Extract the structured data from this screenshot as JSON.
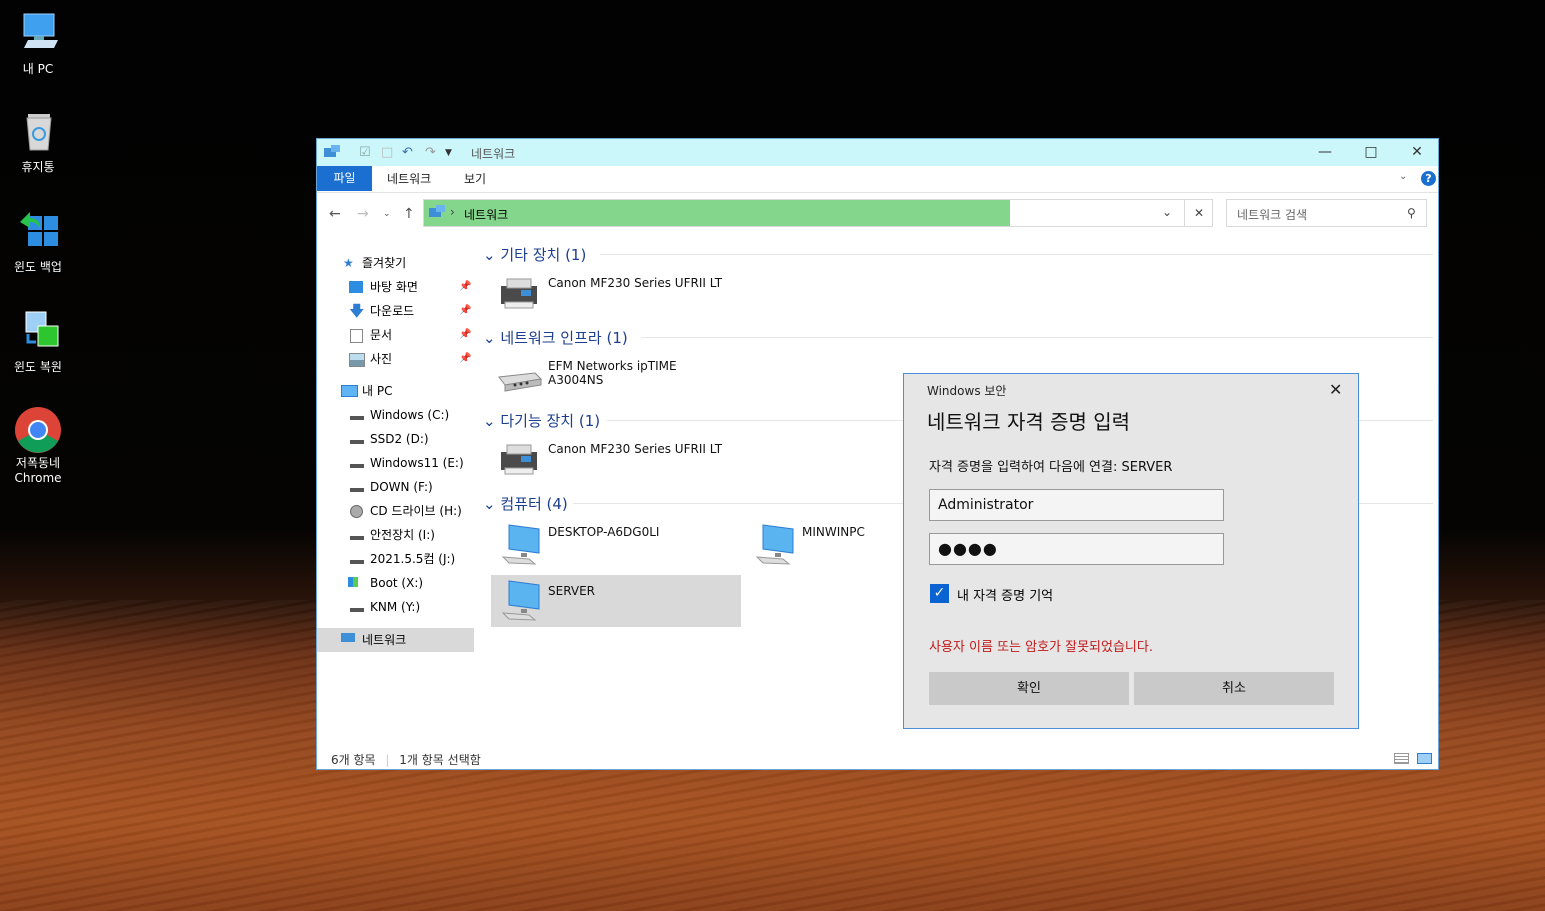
{
  "desktop": {
    "icons": [
      {
        "label": "내 PC"
      },
      {
        "label": "휴지통"
      },
      {
        "label": "윈도 백업"
      },
      {
        "label": "윈도 복원"
      },
      {
        "label": "저폭동네\nChrome"
      }
    ]
  },
  "explorer": {
    "title": "네트워크",
    "tabs": {
      "file": "파일",
      "network": "네트워크",
      "view": "보기"
    },
    "address": "네트워크",
    "search_placeholder": "네트워크 검색",
    "nav": [
      {
        "label": "즐겨찾기"
      },
      {
        "label": "바탕 화면"
      },
      {
        "label": "다운로드"
      },
      {
        "label": "문서"
      },
      {
        "label": "사진"
      },
      {
        "label": "내 PC"
      },
      {
        "label": "Windows (C:)"
      },
      {
        "label": "SSD2 (D:)"
      },
      {
        "label": "Windows11 (E:)"
      },
      {
        "label": "DOWN (F:)"
      },
      {
        "label": "CD 드라이브 (H:)"
      },
      {
        "label": "안전장치 (I:)"
      },
      {
        "label": "2021.5.5컴 (J:)"
      },
      {
        "label": "Boot (X:)"
      },
      {
        "label": "KNM (Y:)"
      },
      {
        "label": "네트워크"
      }
    ],
    "groups": [
      {
        "label": "기타 장치 (1)",
        "items": [
          "Canon MF230 Series UFRII LT"
        ]
      },
      {
        "label": "네트워크 인프라 (1)",
        "items": [
          "EFM Networks ipTIME A3004NS"
        ]
      },
      {
        "label": "다기능 장치 (1)",
        "items": [
          "Canon MF230 Series UFRII LT"
        ]
      },
      {
        "label": "컴퓨터 (4)",
        "items": [
          "DESKTOP-A6DG0LI",
          "MINWINPC",
          "SERVER"
        ]
      }
    ],
    "status": {
      "count": "6개 항목",
      "selected": "1개 항목 선택함"
    }
  },
  "dialog": {
    "caption": "Windows 보안",
    "heading": "네트워크 자격 증명 입력",
    "subtitle": "자격 증명을 입력하여 다음에 연결: SERVER",
    "username": "Administrator",
    "password_mask": "●●●●",
    "remember_label": "내 자격 증명 기억",
    "remember_checked": true,
    "error": "사용자 이름 또는 암호가 잘못되었습니다.",
    "ok_label": "확인",
    "cancel_label": "취소"
  },
  "colors": {
    "accent": "#1a6fd1",
    "selection": "#d9d9d9",
    "address_fill": "#84d68c",
    "error": "#c21a1a"
  }
}
